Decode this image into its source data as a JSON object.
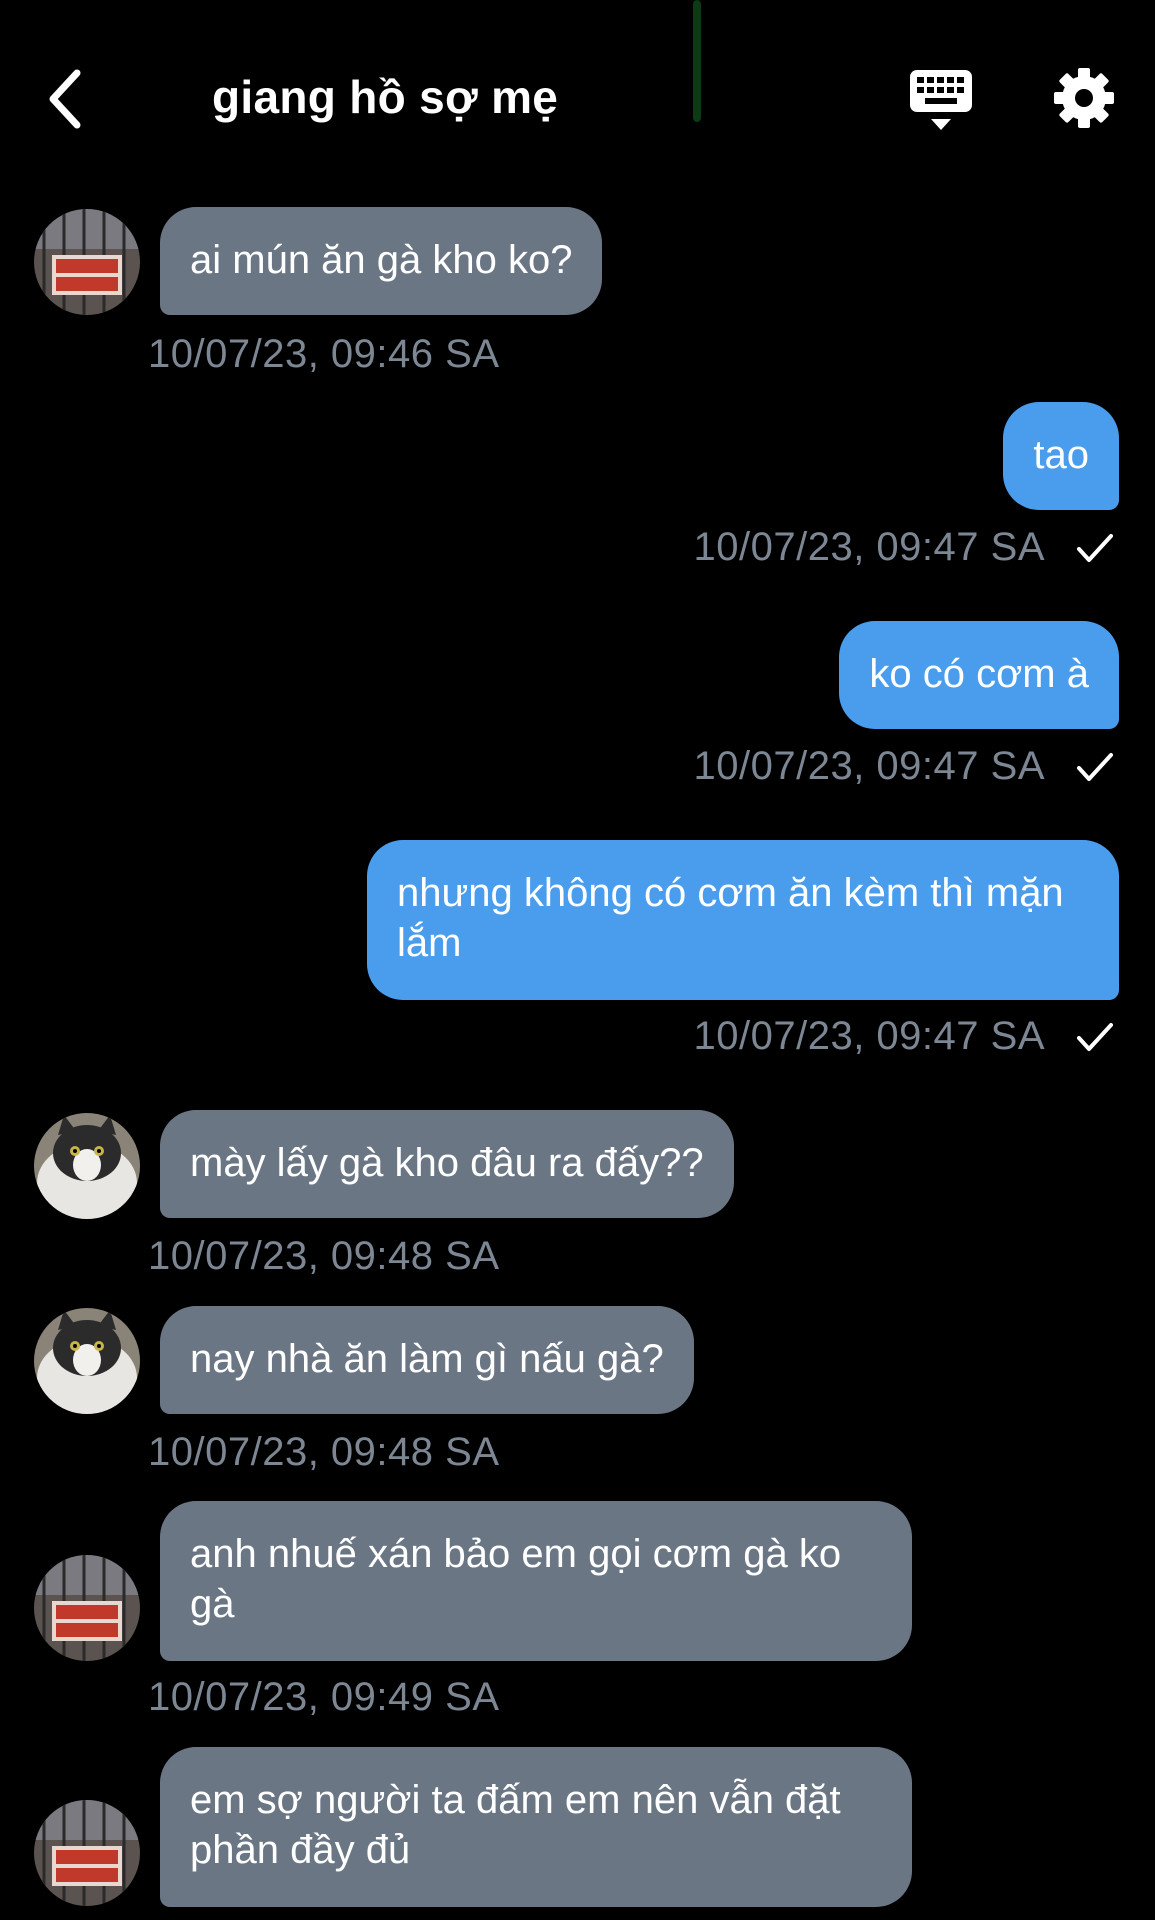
{
  "header": {
    "title": "giang hồ sợ mẹ"
  },
  "messages": [
    {
      "text": "ai mún ăn gà kho ko?",
      "time": "10/07/23, 09:46 SA"
    },
    {
      "text": "tao",
      "time": "10/07/23, 09:47 SA"
    },
    {
      "text": "ko có cơm à",
      "time": "10/07/23, 09:47 SA"
    },
    {
      "text": "nhưng không có cơm ăn kèm thì mặn lắm",
      "time": "10/07/23, 09:47 SA"
    },
    {
      "text": "mày lấy gà kho đâu ra đấy??",
      "time": "10/07/23, 09:48 SA"
    },
    {
      "text": "nay nhà ăn làm gì nấu gà?",
      "time": "10/07/23, 09:48 SA"
    },
    {
      "text": "anh nhuế xán bảo em gọi cơm gà ko gà",
      "time": "10/07/23, 09:49 SA"
    },
    {
      "text": "em sợ người ta đấm em nên vẫn đặt phần đầy đủ",
      "time": ""
    }
  ],
  "colors": {
    "incoming_bubble": "#6b7685",
    "outgoing_bubble": "#4a9ded",
    "timestamp": "#7d8794",
    "background": "#000000"
  },
  "icons": {
    "back": "chevron-left-icon",
    "keyboard": "keyboard-hide-icon",
    "settings": "gear-icon",
    "read": "check-icon"
  }
}
